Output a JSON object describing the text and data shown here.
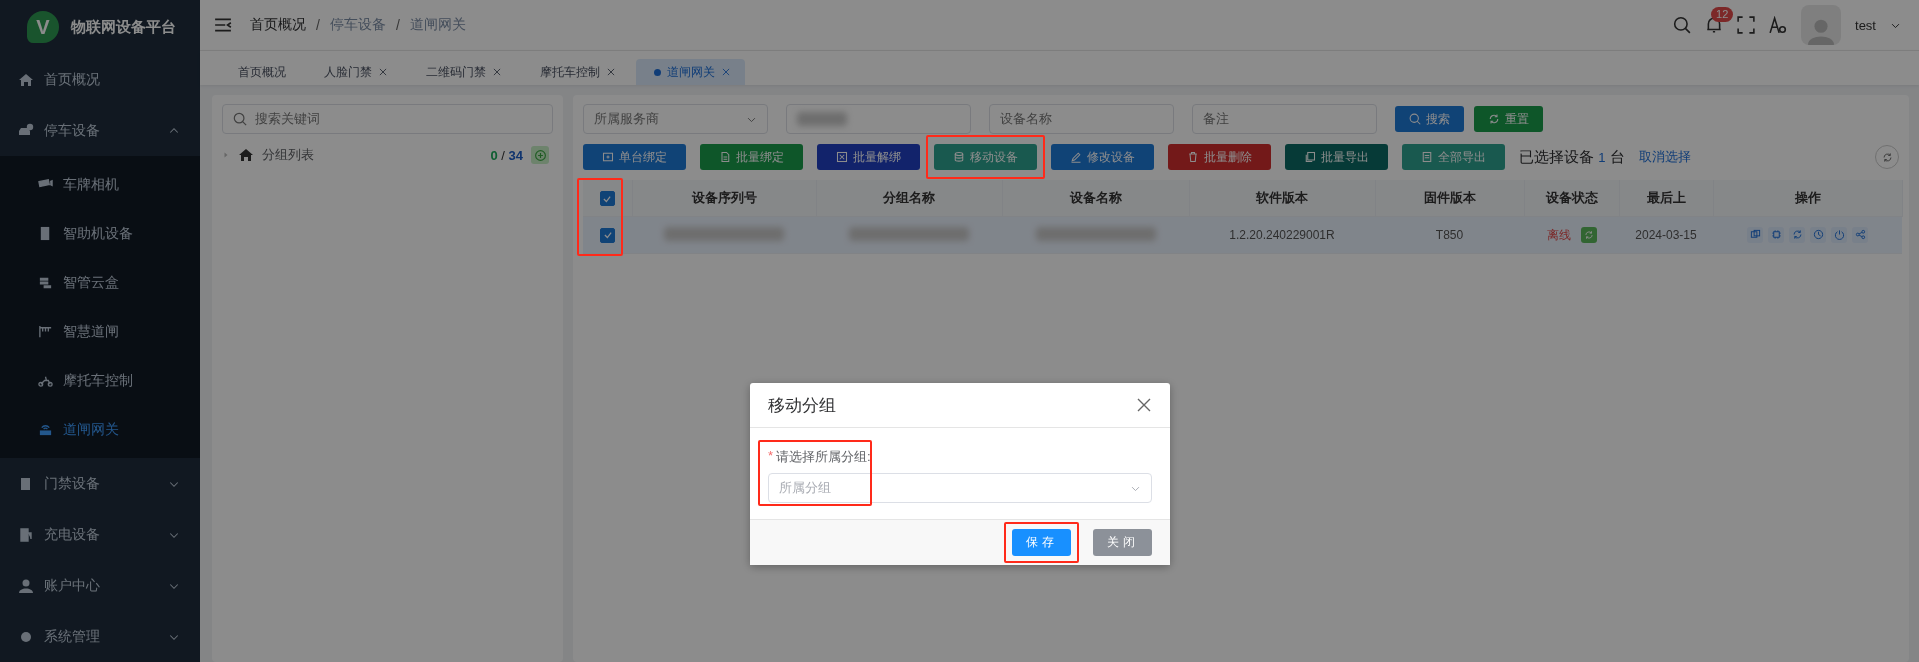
{
  "app": {
    "logo_letter": "V",
    "title": "物联网设备平台"
  },
  "sidebar": {
    "items": [
      {
        "kind": "link",
        "label": "首页概况",
        "selected": false
      },
      {
        "kind": "group",
        "label": "停车设备",
        "expanded": true,
        "children": [
          {
            "label": "车牌相机",
            "selected": false
          },
          {
            "label": "智助机设备",
            "selected": false
          },
          {
            "label": "智管云盒",
            "selected": false
          },
          {
            "label": "智慧道闸",
            "selected": false
          },
          {
            "label": "摩托车控制",
            "selected": false
          },
          {
            "label": "道闸网关",
            "selected": true
          }
        ]
      },
      {
        "kind": "group",
        "label": "门禁设备",
        "expanded": false
      },
      {
        "kind": "group",
        "label": "充电设备",
        "expanded": false
      },
      {
        "kind": "group",
        "label": "账户中心",
        "expanded": false
      },
      {
        "kind": "group",
        "label": "系统管理",
        "expanded": false
      }
    ]
  },
  "header": {
    "breadcrumb": [
      "首页概况",
      "停车设备",
      "道闸网关"
    ],
    "breadcrumb_separator": "/",
    "notification_count": "12",
    "user_name": "test"
  },
  "tabs": [
    {
      "label": "首页概况",
      "closable": false,
      "selected": false
    },
    {
      "label": "人脸门禁",
      "closable": true,
      "selected": false
    },
    {
      "label": "二维码门禁",
      "closable": true,
      "selected": false
    },
    {
      "label": "摩托车控制",
      "closable": true,
      "selected": false
    },
    {
      "label": "道闸网关",
      "closable": true,
      "selected": true
    }
  ],
  "tree": {
    "search_placeholder": "搜索关键词",
    "root": {
      "label": "分组列表",
      "selected_count": "0",
      "count_separator": "/",
      "total_count": "34"
    }
  },
  "filters": [
    {
      "kind": "select",
      "placeholder": "所属服务商"
    },
    {
      "kind": "redacted"
    },
    {
      "kind": "input",
      "placeholder": "设备名称"
    },
    {
      "kind": "input",
      "placeholder": "备注"
    }
  ],
  "filter_buttons": [
    {
      "label": "搜索",
      "kind": "primary"
    },
    {
      "label": "重置",
      "kind": "success"
    }
  ],
  "actions": [
    {
      "label": "单台绑定",
      "kind": "primary",
      "highlighted": false
    },
    {
      "label": "批量绑定",
      "kind": "success",
      "highlighted": false
    },
    {
      "label": "批量解绑",
      "kind": "indigo",
      "highlighted": false
    },
    {
      "label": "移动设备",
      "kind": "teal",
      "highlighted": true
    },
    {
      "label": "修改设备",
      "kind": "primary",
      "highlighted": false
    },
    {
      "label": "批量删除",
      "kind": "danger",
      "highlighted": false
    },
    {
      "label": "批量导出",
      "kind": "dark",
      "highlighted": false
    },
    {
      "label": "全部导出",
      "kind": "teal",
      "highlighted": false
    }
  ],
  "selection": {
    "prefix": "已选择设备",
    "count": "1",
    "unit": "台",
    "clear_link": "取消选择"
  },
  "table": {
    "checkbox_column_highlighted": true,
    "header_checked": true,
    "columns": [
      "设备序列号",
      "分组名称",
      "设备名称",
      "软件版本",
      "固件版本",
      "设备状态",
      "最后上",
      "操作"
    ],
    "rows": [
      {
        "selected": true,
        "cells": [
          {
            "kind": "redacted"
          },
          {
            "kind": "redacted"
          },
          {
            "kind": "redacted"
          },
          {
            "kind": "text",
            "text": "1.2.20.240229001R"
          },
          {
            "kind": "text",
            "text": "T850"
          },
          {
            "kind": "status",
            "text": "离线",
            "online": false
          },
          {
            "kind": "text",
            "text": "2024-03-15"
          },
          {
            "kind": "actions"
          }
        ]
      }
    ]
  },
  "modal": {
    "title": "移动分组",
    "field_label": "请选择所属分组:",
    "required_mark": "*",
    "placeholder": "所属分组",
    "field_highlighted": true,
    "buttons": [
      {
        "label": "保存",
        "kind": "primary",
        "highlighted": true
      },
      {
        "label": "关闭",
        "kind": "secondary",
        "highlighted": false
      }
    ]
  }
}
